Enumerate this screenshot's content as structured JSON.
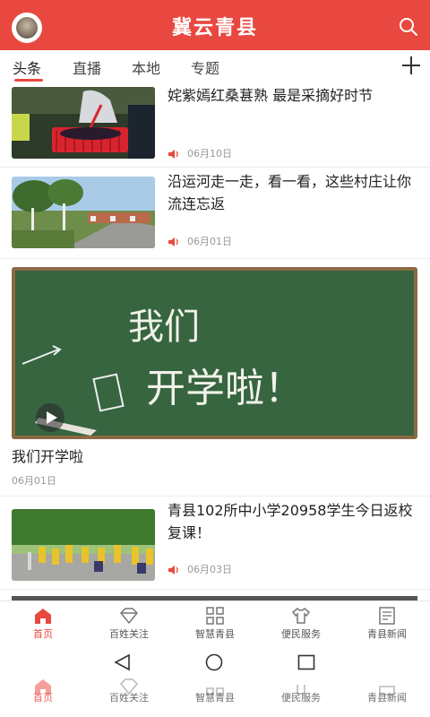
{
  "header": {
    "title": "冀云青县"
  },
  "tabs": [
    {
      "label": "头条",
      "active": true
    },
    {
      "label": "直播",
      "active": false
    },
    {
      "label": "本地",
      "active": false
    },
    {
      "label": "专题",
      "active": false
    }
  ],
  "feed": {
    "items": [
      {
        "title": "姹紫嫣红桑葚熟 最是采摘好时节",
        "date": "06月10日"
      },
      {
        "title": "沿运河走一走，看一看，这些村庄让你流连忘返",
        "date": "06月01日"
      },
      {
        "title": "我们开学啦",
        "date": "06月01日",
        "image_text_1": "我们",
        "image_text_2": "开学啦！"
      },
      {
        "title": "青县102所中小学20958学生今日返校复课！",
        "date": "06月03日"
      }
    ]
  },
  "bottom_nav": [
    {
      "label": "首页",
      "active": true,
      "icon": "home-icon"
    },
    {
      "label": "百姓关注",
      "active": false,
      "icon": "diamond-icon"
    },
    {
      "label": "智慧青县",
      "active": false,
      "icon": "grid-icon"
    },
    {
      "label": "便民服务",
      "active": false,
      "icon": "shirt-icon"
    },
    {
      "label": "青县新闻",
      "active": false,
      "icon": "news-icon"
    }
  ],
  "colors": {
    "accent": "#e8483f"
  }
}
